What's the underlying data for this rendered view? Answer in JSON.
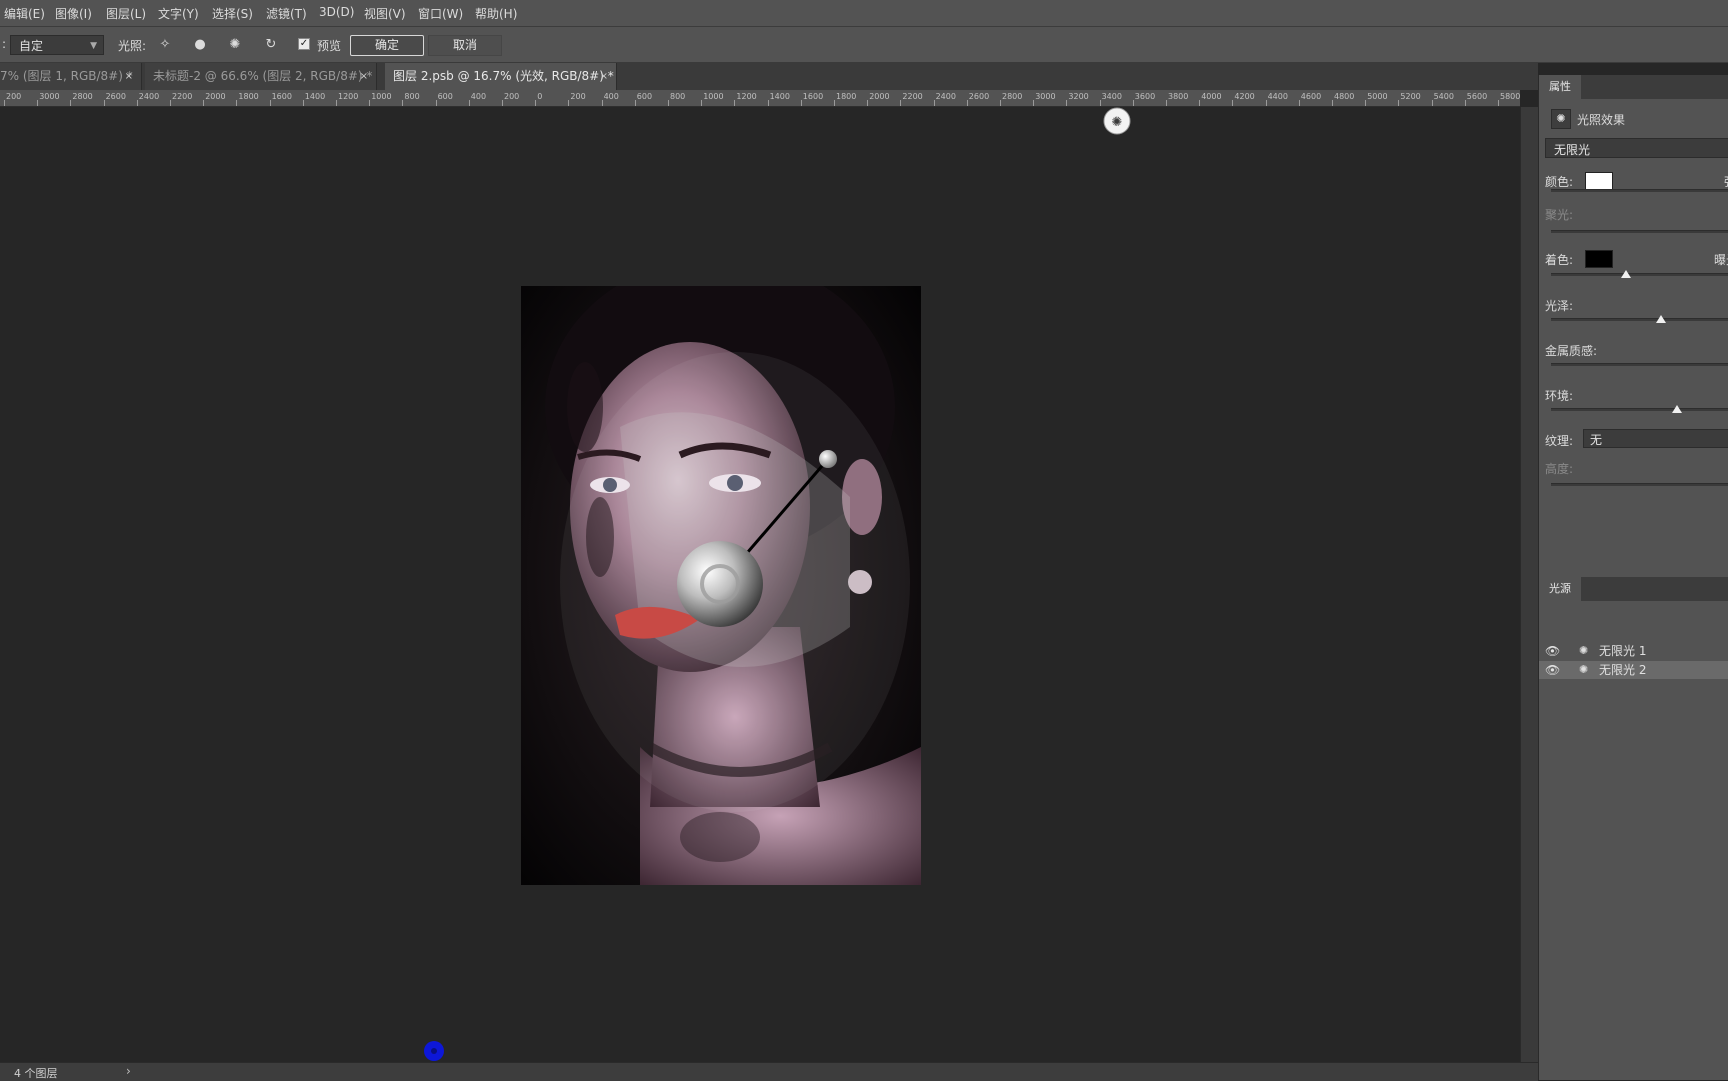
{
  "menu": [
    "编辑(E)",
    "图像(I)",
    "图层(L)",
    "文字(Y)",
    "选择(S)",
    "滤镜(T)",
    "3D(D)",
    "视图(V)",
    "窗口(W)",
    "帮助(H)"
  ],
  "options": {
    "preset_value": "自定",
    "lights_label": "光照:",
    "preview_label": "预览",
    "preview_checked": true,
    "ok_label": "确定",
    "cancel_label": "取消"
  },
  "tabs": [
    {
      "label": "7% (图层 1, RGB/8#) *",
      "close": "×"
    },
    {
      "label": "未标题-2 @ 66.6% (图层 2, RGB/8#) *",
      "close": "×"
    },
    {
      "label": "图层 2.psb @ 16.7% (光效, RGB/8#) *",
      "close": "×",
      "active": true
    }
  ],
  "ruler_ticks": [
    "200",
    "3000",
    "2800",
    "2600",
    "2400",
    "2200",
    "2000",
    "1800",
    "1600",
    "1400",
    "1200",
    "1000",
    "800",
    "600",
    "400",
    "200",
    "0",
    "200",
    "400",
    "600",
    "800",
    "1000",
    "1200",
    "1400",
    "1600",
    "1800",
    "2000",
    "2200",
    "2400",
    "2600",
    "2800",
    "3000",
    "3200",
    "3400",
    "3600",
    "3800",
    "4000",
    "4200",
    "4400",
    "4600",
    "4800",
    "5000",
    "5200",
    "5400",
    "5600",
    "5800"
  ],
  "status": {
    "layers_count": "4 个图层",
    "arrow": "›"
  },
  "panel": {
    "tab_properties": "属性",
    "header_title": "光照效果",
    "light_type": "无限光",
    "color_label": "颜色:",
    "color_value": "#ffffff",
    "intensity_label": "强度",
    "hotspot_label": "聚光:",
    "colorize_label": "着色:",
    "colorize_value": "#000000",
    "exposure_label": "曝光",
    "gloss_label": "光泽:",
    "metallic_label": "金属质感:",
    "ambience_label": "环境:",
    "texture_label": "纹理:",
    "texture_value": "无",
    "height_label": "高度:",
    "sliders": {
      "colorize": 0.42,
      "gloss": 0.62,
      "metallic": 1.0,
      "ambience": 0.71
    },
    "tab_lights": "光源",
    "lights": [
      {
        "label": "无限光 1",
        "selected": false
      },
      {
        "label": "无限光 2",
        "selected": true
      }
    ]
  }
}
